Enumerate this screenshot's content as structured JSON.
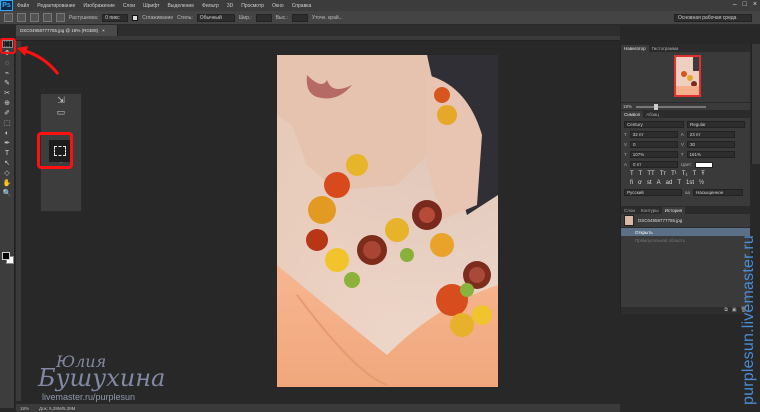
{
  "menubar": {
    "logo": "Ps",
    "items": [
      "Файл",
      "Редактирование",
      "Изображение",
      "Слои",
      "Шрифт",
      "Выделение",
      "Фильтр",
      "3D",
      "Просмотр",
      "Окно",
      "Справка"
    ],
    "window_controls": [
      "–",
      "□",
      "×"
    ]
  },
  "options_bar": {
    "feather_label": "Растушевка:",
    "feather_value": "0 пикс",
    "antialias_label": "Сглаживание",
    "style_label": "Стиль:",
    "style_value": "Обычный",
    "width_label": "Шир.:",
    "height_label": "Выс.:",
    "refine_label": "Уточн. край...",
    "workspace": "Основная рабочая среда"
  },
  "document": {
    "tab_title": "DSC04958777755.jpg @ 18% (RGB/8)",
    "close": "×"
  },
  "tools": [
    "⬚",
    "✥",
    "◌",
    "⌁",
    "✎",
    "✂",
    "⊕",
    "✐",
    "⬚",
    "◐",
    "✒",
    "T",
    "↖",
    "◇",
    "✋",
    "🔍"
  ],
  "flyout": {
    "rows": [
      "⇲",
      "▭",
      "⟳",
      "✳"
    ]
  },
  "navigator": {
    "tabs": [
      "Навигатор",
      "Гистограмма"
    ],
    "zoom": "18%"
  },
  "character": {
    "tabs": [
      "Символ",
      "Абзац"
    ],
    "font_family": "Century",
    "font_style": "Regular",
    "size": "32 пт",
    "leading": "23 пт",
    "kerning": "0",
    "tracking": "30",
    "vscale": "107%",
    "hscale": "161%",
    "baseline": "0 пт",
    "color_label": "Цвет:",
    "format_icons": [
      "T",
      "T",
      "TT",
      "Tт",
      "T¹",
      "T₁",
      "T",
      "Ŧ"
    ],
    "opentype_icons": [
      "fi",
      "ơ",
      "st",
      "A",
      "ad",
      "T",
      "1st",
      "½"
    ],
    "language": "Русский",
    "aa_short": "aa",
    "aa_mode": "Насыщенное"
  },
  "history": {
    "tabs": [
      "Слои",
      "Контуры",
      "История"
    ],
    "source": "DSC04958777755.jpg",
    "steps": [
      {
        "label": "Открыть",
        "state": "selected"
      },
      {
        "label": "Прямоугольная область",
        "state": "dim"
      }
    ],
    "footer_icons": [
      "⧉",
      "▣",
      "🗑"
    ]
  },
  "status": {
    "zoom": "18%",
    "doc_size": "Док: 5,39M/5,39M"
  },
  "watermark": {
    "first_name": "Юлия",
    "last_name": "Бушухина",
    "url": "livemaster.ru/purplesun",
    "vertical": "purplesun.livemaster.ru"
  }
}
